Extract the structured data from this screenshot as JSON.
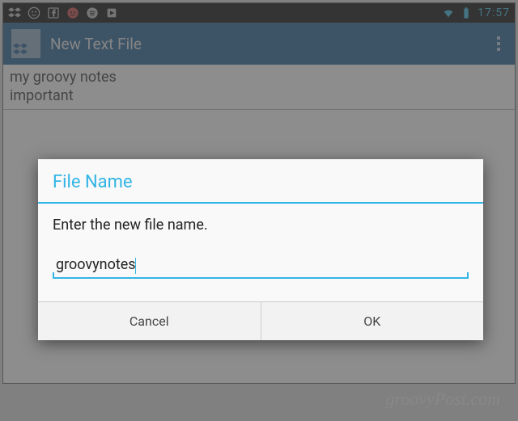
{
  "statusbar": {
    "clock": "17:57"
  },
  "actionbar": {
    "title": "New Text File"
  },
  "editor": {
    "line1": "my groovy notes",
    "line2": "important"
  },
  "dialog": {
    "title": "File Name",
    "message": "Enter the new file name.",
    "input_value": "groovynotes",
    "cancel": "Cancel",
    "ok": "OK"
  },
  "watermark": "groovyPost.com"
}
